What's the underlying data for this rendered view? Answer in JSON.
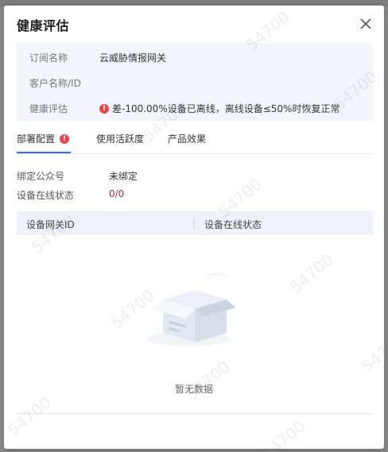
{
  "modal": {
    "title": "健康评估",
    "close_icon": "close-icon"
  },
  "info": {
    "rows": [
      {
        "label": "订阅名称",
        "value": "云威胁情报网关"
      },
      {
        "label": "客户名称/ID",
        "value": ""
      },
      {
        "label": "健康评估",
        "value": "差-100.00%设备已离线，离线设备≤50%时恢复正常",
        "status_icon": "warning-icon"
      }
    ]
  },
  "tabs": [
    {
      "label": "部署配置",
      "active": true,
      "has_warning": true
    },
    {
      "label": "使用活跃度",
      "active": false
    },
    {
      "label": "产品效果",
      "active": false
    }
  ],
  "deploy": {
    "bind_label": "绑定公众号",
    "bind_value": "未绑定",
    "online_label": "设备在线状态",
    "online_value": "0/0"
  },
  "table": {
    "columns": [
      "设备网关ID",
      "设备在线状态"
    ],
    "empty_text": "暂无数据"
  },
  "watermark": "54700",
  "colors": {
    "accent": "#2f6ff5",
    "warning": "#e5474a",
    "value_red": "#b3282d",
    "panel_bg": "#f3f5fa"
  }
}
